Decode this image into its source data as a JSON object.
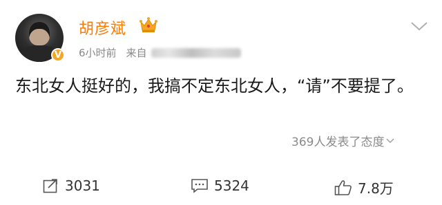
{
  "user": {
    "name": "胡彦斌",
    "verified_badge": "V"
  },
  "post": {
    "time": "6小时前",
    "source_prefix": "来自",
    "content": "东北女人挺好的，我搞不定东北女人，“请”不要提了。"
  },
  "reactions": {
    "summary": "369人发表了态度"
  },
  "actions": {
    "repost_count": "3031",
    "comment_count": "5324",
    "like_count": "7.8万"
  },
  "icons": {
    "crown": "crown-icon",
    "more": "chevron-down-icon",
    "repost": "repost-icon",
    "comment": "comment-icon",
    "like": "thumbs-up-icon"
  },
  "colors": {
    "name": "#ff7a00",
    "badge": "#f5a623",
    "meta": "#888888"
  }
}
